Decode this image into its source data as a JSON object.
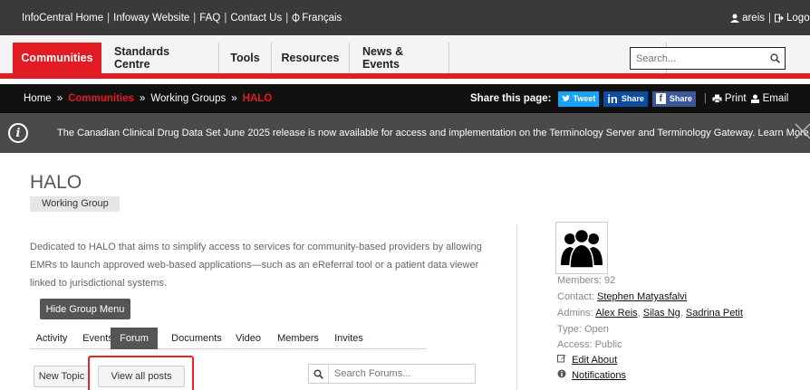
{
  "topbar": {
    "links": [
      "InfoCentral Home",
      "Infoway Website",
      "FAQ",
      "Contact Us",
      "Français"
    ],
    "separator": "|",
    "user": "areis",
    "logout": "Logou"
  },
  "nav": {
    "items": [
      "Communities",
      "Standards Centre",
      "Tools",
      "Resources",
      "News & Events"
    ],
    "active": "Communities",
    "search_placeholder": "Search..."
  },
  "breadcrumb": {
    "home": "Home",
    "communities": "Communities",
    "working_groups": "Working Groups",
    "current": "HALO",
    "arrow": "»"
  },
  "share": {
    "label": "Share this page:",
    "tweet": "Tweet",
    "linkedin_in": "in",
    "linkedin": "Share",
    "facebook_f": "f",
    "facebook": "Share",
    "sep": "|",
    "print": "Print",
    "email": "Email"
  },
  "alert": {
    "info_glyph": "i",
    "message": "The Canadian Clinical Drug Data Set June 2025 release is now available for access and implementation on the Terminology Server and Terminology Gateway. Learn More >",
    "close_glyph": "✕"
  },
  "group": {
    "title": "HALO",
    "type_badge": "Working Group",
    "description": [
      "Dedicated to HALO that aims to simplify access to services for community-based providers by allowing",
      "EMRs to launch approved web-based applications—such as an eReferral tool or a patient data viewer",
      "linked to jurisdictional systems."
    ],
    "hide_menu": "Hide Group Menu"
  },
  "tabs": [
    "Activity",
    "Events",
    "Forum",
    "Documents",
    "Video",
    "Members",
    "Invites"
  ],
  "active_tab": "Forum",
  "forum": {
    "new_topic": "New Topic",
    "view_all": "View all posts",
    "search_placeholder": "Search Forums..."
  },
  "sidebar": {
    "members_label": "Members:",
    "members_count": "92",
    "contact_label": "Contact:",
    "contact": "Stephen Matyasfalvi",
    "admins_label": "Admins:",
    "admins": [
      "Alex Reis",
      "Silas Ng",
      "Sadrina Petit"
    ],
    "type_label": "Type:",
    "type_value": "Open",
    "access_label": "Access:",
    "access_value": "Public",
    "edit_about": "Edit About",
    "notifications": "Notifications"
  },
  "colors": {
    "brand_red": "#e31b23",
    "topbar": "#3a3a3a",
    "breadcrumb_bar": "#111111",
    "alert_bar": "#4a4a4a"
  }
}
